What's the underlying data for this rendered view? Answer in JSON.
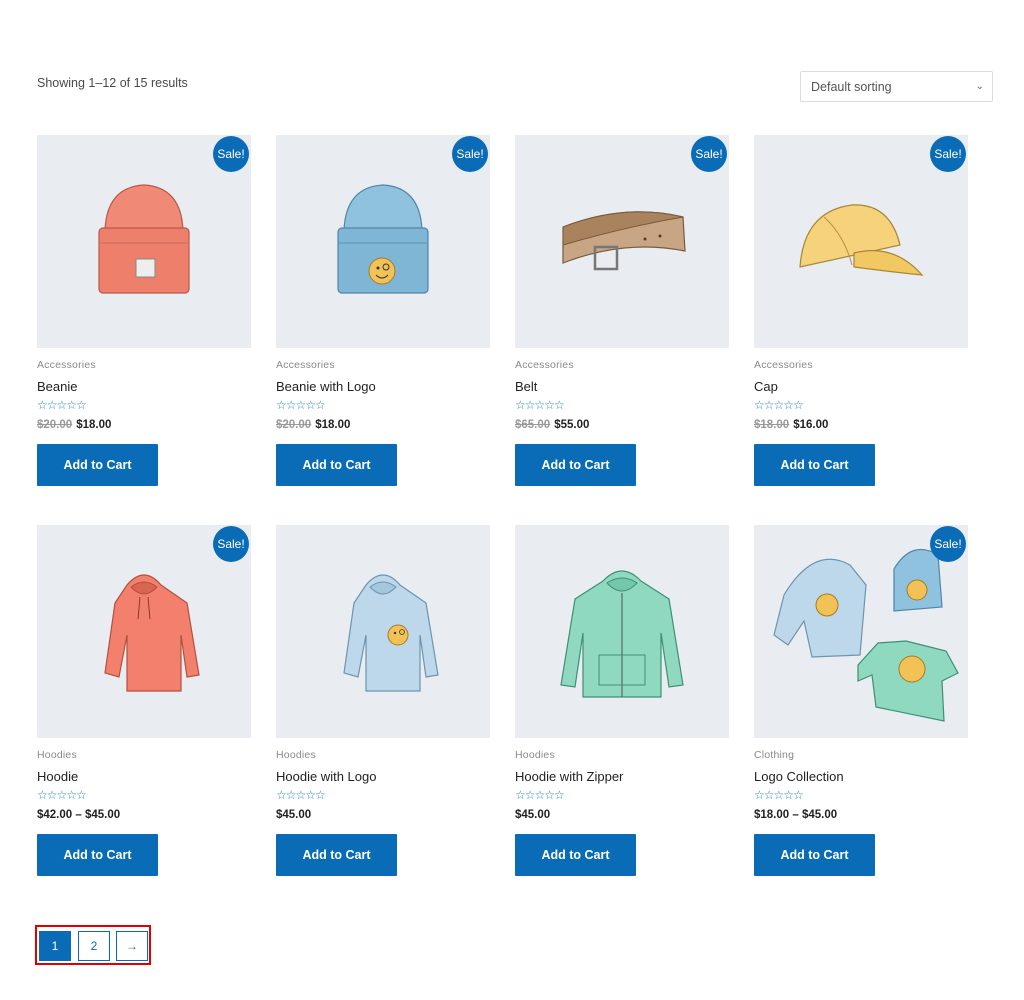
{
  "shop": {
    "result_count": "Showing 1–12 of 15 results",
    "sorting": {
      "selected": "Default sorting"
    }
  },
  "colors": {
    "accent": "#0a6cb6",
    "thumb_bg": "#e9edf1",
    "highlight": "#e00000"
  },
  "rating_glyph": "☆☆☆☆☆",
  "products": [
    {
      "category": "Accessories",
      "name": "Beanie",
      "sale_badge": "Sale!",
      "old_price": "$20.00",
      "price": "$18.00",
      "button": "Add to Cart",
      "image_icon": "beanie-icon"
    },
    {
      "category": "Accessories",
      "name": "Beanie with Logo",
      "sale_badge": "Sale!",
      "old_price": "$20.00",
      "price": "$18.00",
      "button": "Add to Cart",
      "image_icon": "beanie-logo-icon"
    },
    {
      "category": "Accessories",
      "name": "Belt",
      "sale_badge": "Sale!",
      "old_price": "$65.00",
      "price": "$55.00",
      "button": "Add to Cart",
      "image_icon": "belt-icon"
    },
    {
      "category": "Accessories",
      "name": "Cap",
      "sale_badge": "Sale!",
      "old_price": "$18.00",
      "price": "$16.00",
      "button": "Add to Cart",
      "image_icon": "cap-icon"
    },
    {
      "category": "Hoodies",
      "name": "Hoodie",
      "sale_badge": "Sale!",
      "old_price": "",
      "price": "$42.00 – $45.00",
      "button": "Add to Cart",
      "image_icon": "hoodie-icon"
    },
    {
      "category": "Hoodies",
      "name": "Hoodie with Logo",
      "sale_badge": "",
      "old_price": "",
      "price": "$45.00",
      "button": "Add to Cart",
      "image_icon": "hoodie-logo-icon"
    },
    {
      "category": "Hoodies",
      "name": "Hoodie with Zipper",
      "sale_badge": "",
      "old_price": "",
      "price": "$45.00",
      "button": "Add to Cart",
      "image_icon": "hoodie-zipper-icon"
    },
    {
      "category": "Clothing",
      "name": "Logo Collection",
      "sale_badge": "Sale!",
      "old_price": "",
      "price": "$18.00 – $45.00",
      "button": "Add to Cart",
      "image_icon": "logo-collection-icon"
    }
  ],
  "pagination": {
    "current": "1",
    "page2": "2",
    "next": "→"
  }
}
